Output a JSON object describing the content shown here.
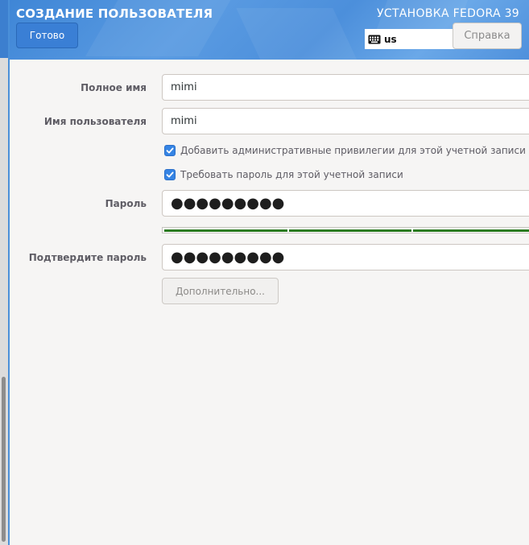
{
  "header": {
    "title": "СОЗДАНИЕ ПОЛЬЗОВАТЕЛЯ",
    "product": "УСТАНОВКА FEDORA 39",
    "done_label": "Готово",
    "keyboard_layout": "us",
    "help_label": "Справка"
  },
  "form": {
    "full_name": {
      "label": "Полное имя",
      "value": "mimi"
    },
    "username": {
      "label": "Имя пользователя",
      "value": "mimi"
    },
    "admin_checkbox": {
      "label": "Добавить административные привилегии для этой учетной записи по",
      "checked": true
    },
    "require_password_checkbox": {
      "label": "Требовать пароль для этой учетной записи",
      "checked": true
    },
    "password": {
      "label": "Пароль",
      "masked": "●●●●●●●●●"
    },
    "password_strength": {
      "filled_segments": 3
    },
    "confirm_password": {
      "label": "Подтвердите пароль",
      "masked": "●●●●●●●●●"
    },
    "advanced_label": "Дополнительно..."
  },
  "colors": {
    "accent": "#3584e4",
    "header_blue": "#4c8fdb",
    "strength_green": "#2a7a20"
  }
}
